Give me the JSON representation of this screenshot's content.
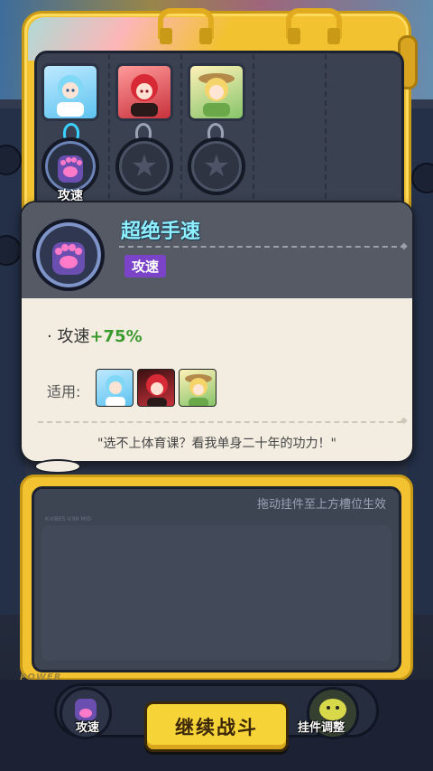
{
  "colors": {
    "bag_yellow": "#f2c230",
    "popup_title": "#8ff0ff",
    "tag_purple": "#7a43c8",
    "stat_green": "#3a9a2e",
    "button_yellow": "#f6d336"
  },
  "slots": [
    {
      "character_icon": "blue-hair-girl-icon",
      "charm_icon": "cat-paw-icon",
      "charm_label": "攻速"
    },
    {
      "character_icon": "red-hair-girl-icon",
      "charm_icon": "star-icon",
      "charm_label": ""
    },
    {
      "character_icon": "blonde-girl-icon",
      "charm_icon": "star-icon",
      "charm_label": ""
    }
  ],
  "popup": {
    "title": "超绝手速",
    "tag": "攻速",
    "stat_prefix": "· 攻速",
    "stat_value": "+75%",
    "applies_label": "适用:",
    "applies_icons": [
      "blue-hair-girl-icon",
      "red-hair-girl-icon",
      "blonde-girl-icon"
    ],
    "quote": "\"选不上体育课？看我单身二十年的功力！\""
  },
  "storage": {
    "hint": "拖动挂件至上方槽位生效",
    "small_text": "K-VIBES V.99 MID",
    "brand": "POWER"
  },
  "bottom": {
    "left_label": "攻速",
    "continue_label": "继续战斗",
    "right_label": "挂件调整"
  }
}
